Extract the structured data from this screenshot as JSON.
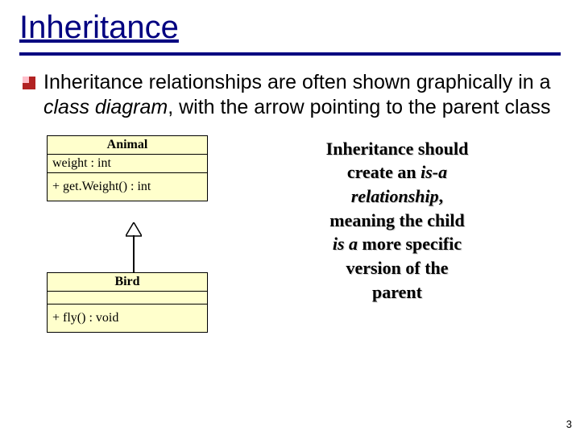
{
  "title": "Inheritance",
  "bullet": {
    "prefix": "Inheritance relationships are often shown graphically in a ",
    "italic": "class diagram",
    "suffix": ", with the arrow pointing to the parent class"
  },
  "uml": {
    "parent": {
      "name": "Animal",
      "attribute": "weight : int",
      "operation": "+ get.Weight() : int"
    },
    "child": {
      "name": "Bird",
      "operation": "+ fly() : void"
    }
  },
  "sideNote": {
    "l1": "Inheritance should",
    "l2a": "create an ",
    "l2b": "is-a",
    "l3a": "relationship",
    "l3b": ",",
    "l4": "meaning the child",
    "l5a": "is a",
    "l5b": " more specific",
    "l6": "version of the",
    "l7": "parent"
  },
  "pageNumber": "3"
}
